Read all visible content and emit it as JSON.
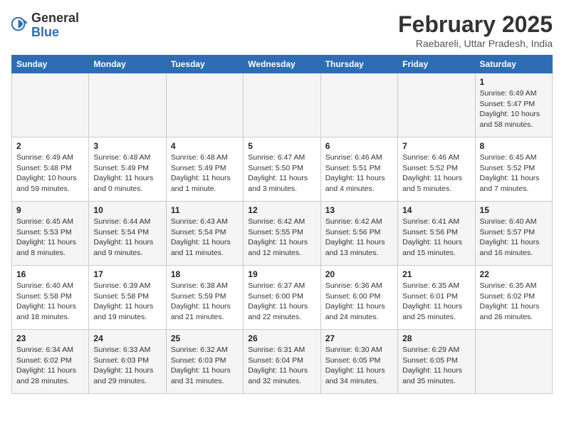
{
  "header": {
    "logo": {
      "general": "General",
      "blue": "Blue"
    },
    "title": "February 2025",
    "location": "Raebareli, Uttar Pradesh, India"
  },
  "days_of_week": [
    "Sunday",
    "Monday",
    "Tuesday",
    "Wednesday",
    "Thursday",
    "Friday",
    "Saturday"
  ],
  "weeks": [
    [
      {
        "day": "",
        "info": ""
      },
      {
        "day": "",
        "info": ""
      },
      {
        "day": "",
        "info": ""
      },
      {
        "day": "",
        "info": ""
      },
      {
        "day": "",
        "info": ""
      },
      {
        "day": "",
        "info": ""
      },
      {
        "day": "1",
        "info": "Sunrise: 6:49 AM\nSunset: 5:47 PM\nDaylight: 10 hours\nand 58 minutes."
      }
    ],
    [
      {
        "day": "2",
        "info": "Sunrise: 6:49 AM\nSunset: 5:48 PM\nDaylight: 10 hours\nand 59 minutes."
      },
      {
        "day": "3",
        "info": "Sunrise: 6:48 AM\nSunset: 5:49 PM\nDaylight: 11 hours\nand 0 minutes."
      },
      {
        "day": "4",
        "info": "Sunrise: 6:48 AM\nSunset: 5:49 PM\nDaylight: 11 hours\nand 1 minute."
      },
      {
        "day": "5",
        "info": "Sunrise: 6:47 AM\nSunset: 5:50 PM\nDaylight: 11 hours\nand 3 minutes."
      },
      {
        "day": "6",
        "info": "Sunrise: 6:46 AM\nSunset: 5:51 PM\nDaylight: 11 hours\nand 4 minutes."
      },
      {
        "day": "7",
        "info": "Sunrise: 6:46 AM\nSunset: 5:52 PM\nDaylight: 11 hours\nand 5 minutes."
      },
      {
        "day": "8",
        "info": "Sunrise: 6:45 AM\nSunset: 5:52 PM\nDaylight: 11 hours\nand 7 minutes."
      }
    ],
    [
      {
        "day": "9",
        "info": "Sunrise: 6:45 AM\nSunset: 5:53 PM\nDaylight: 11 hours\nand 8 minutes."
      },
      {
        "day": "10",
        "info": "Sunrise: 6:44 AM\nSunset: 5:54 PM\nDaylight: 11 hours\nand 9 minutes."
      },
      {
        "day": "11",
        "info": "Sunrise: 6:43 AM\nSunset: 5:54 PM\nDaylight: 11 hours\nand 11 minutes."
      },
      {
        "day": "12",
        "info": "Sunrise: 6:42 AM\nSunset: 5:55 PM\nDaylight: 11 hours\nand 12 minutes."
      },
      {
        "day": "13",
        "info": "Sunrise: 6:42 AM\nSunset: 5:56 PM\nDaylight: 11 hours\nand 13 minutes."
      },
      {
        "day": "14",
        "info": "Sunrise: 6:41 AM\nSunset: 5:56 PM\nDaylight: 11 hours\nand 15 minutes."
      },
      {
        "day": "15",
        "info": "Sunrise: 6:40 AM\nSunset: 5:57 PM\nDaylight: 11 hours\nand 16 minutes."
      }
    ],
    [
      {
        "day": "16",
        "info": "Sunrise: 6:40 AM\nSunset: 5:58 PM\nDaylight: 11 hours\nand 18 minutes."
      },
      {
        "day": "17",
        "info": "Sunrise: 6:39 AM\nSunset: 5:58 PM\nDaylight: 11 hours\nand 19 minutes."
      },
      {
        "day": "18",
        "info": "Sunrise: 6:38 AM\nSunset: 5:59 PM\nDaylight: 11 hours\nand 21 minutes."
      },
      {
        "day": "19",
        "info": "Sunrise: 6:37 AM\nSunset: 6:00 PM\nDaylight: 11 hours\nand 22 minutes."
      },
      {
        "day": "20",
        "info": "Sunrise: 6:36 AM\nSunset: 6:00 PM\nDaylight: 11 hours\nand 24 minutes."
      },
      {
        "day": "21",
        "info": "Sunrise: 6:35 AM\nSunset: 6:01 PM\nDaylight: 11 hours\nand 25 minutes."
      },
      {
        "day": "22",
        "info": "Sunrise: 6:35 AM\nSunset: 6:02 PM\nDaylight: 11 hours\nand 26 minutes."
      }
    ],
    [
      {
        "day": "23",
        "info": "Sunrise: 6:34 AM\nSunset: 6:02 PM\nDaylight: 11 hours\nand 28 minutes."
      },
      {
        "day": "24",
        "info": "Sunrise: 6:33 AM\nSunset: 6:03 PM\nDaylight: 11 hours\nand 29 minutes."
      },
      {
        "day": "25",
        "info": "Sunrise: 6:32 AM\nSunset: 6:03 PM\nDaylight: 11 hours\nand 31 minutes."
      },
      {
        "day": "26",
        "info": "Sunrise: 6:31 AM\nSunset: 6:04 PM\nDaylight: 11 hours\nand 32 minutes."
      },
      {
        "day": "27",
        "info": "Sunrise: 6:30 AM\nSunset: 6:05 PM\nDaylight: 11 hours\nand 34 minutes."
      },
      {
        "day": "28",
        "info": "Sunrise: 6:29 AM\nSunset: 6:05 PM\nDaylight: 11 hours\nand 35 minutes."
      },
      {
        "day": "",
        "info": ""
      }
    ]
  ]
}
